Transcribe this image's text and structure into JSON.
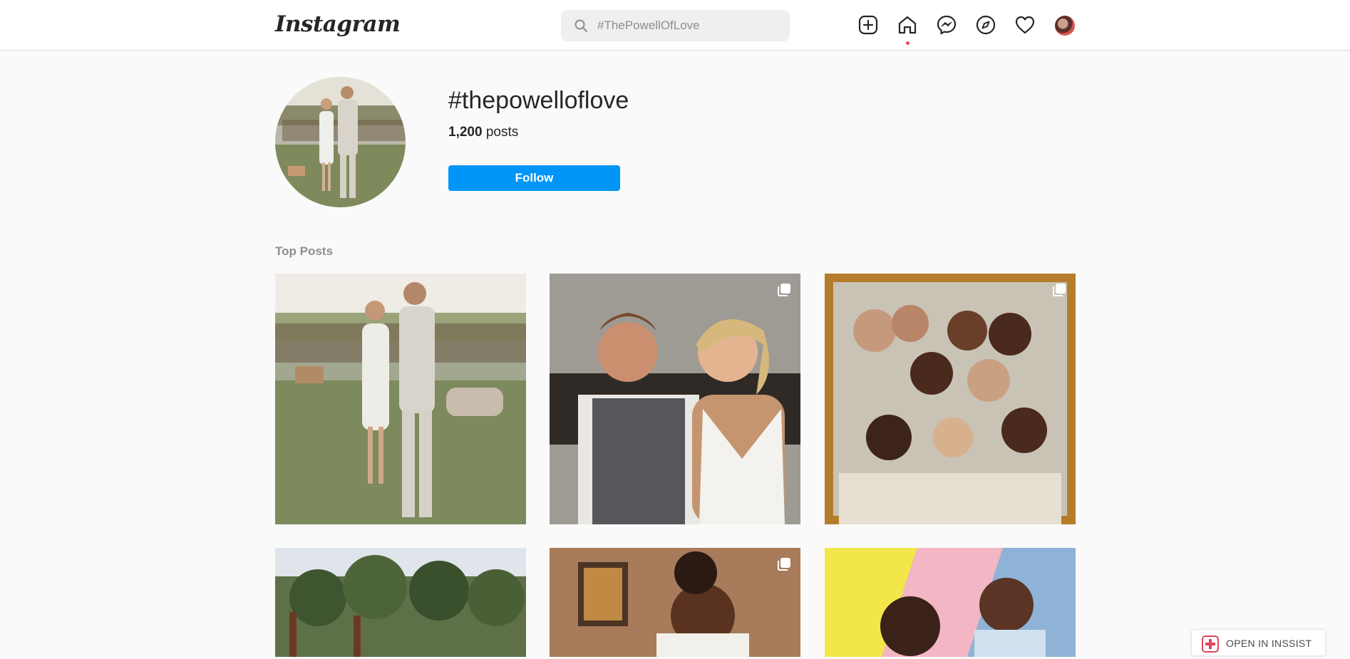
{
  "nav": {
    "logo": "Instagram",
    "search_placeholder": "#ThePowellOfLove"
  },
  "header": {
    "hashtag": "#thepowelloflove",
    "post_count": "1,200",
    "post_count_suffix": " posts",
    "follow_label": "Follow"
  },
  "top_posts": {
    "label": "Top Posts"
  },
  "insist": {
    "label": "OPEN IN INSSIST"
  },
  "colors": {
    "accent": "#0095f6",
    "notification_dot": "#ed4956"
  }
}
